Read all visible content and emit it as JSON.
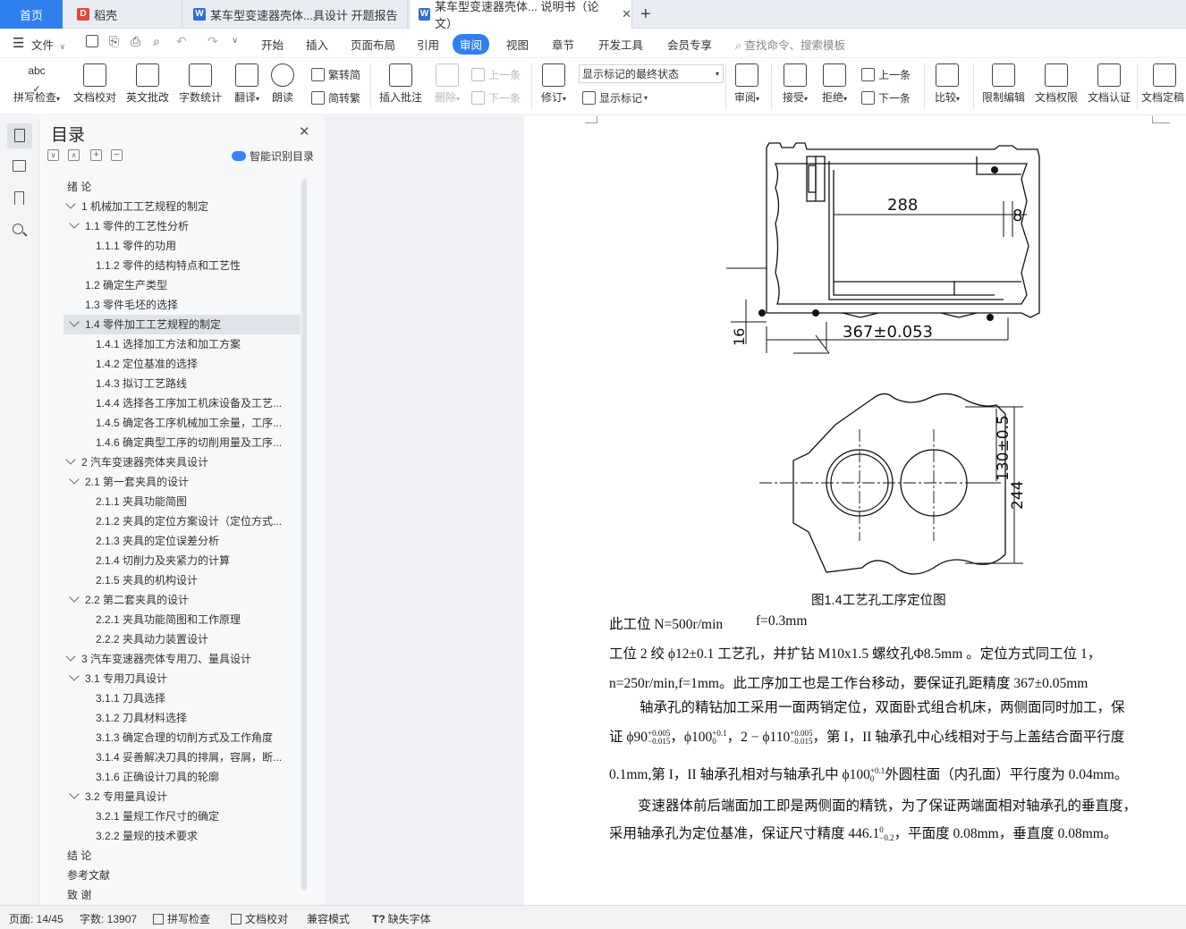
{
  "tabs": {
    "home": "首页",
    "daoke": "稻壳",
    "tab1": "某车型变速器壳体...具设计 开题报告",
    "tab2": "某车型变速器壳体... 说明书（论文）",
    "add": "+"
  },
  "menubar": {
    "file": "文件",
    "items": [
      "开始",
      "插入",
      "页面布局",
      "引用",
      "审阅",
      "视图",
      "章节",
      "开发工具",
      "会员专享"
    ],
    "active_index": 4,
    "search": "查找命令、搜索模板"
  },
  "ribbon": {
    "spell": "拼写检查",
    "proof": "文档校对",
    "en_review": "英文批改",
    "wordcount": "字数统计",
    "translate": "翻译",
    "read": "朗读",
    "trad": "繁转简",
    "simp": "简转繁",
    "insert_comment": "插入批注",
    "delete": "删除",
    "prev_comment": "上一条",
    "next_comment": "下一条",
    "revise": "修订",
    "markup_state": "显示标记的最终状态",
    "show_markup": "显示标记",
    "review": "审阅",
    "accept": "接受",
    "reject": "拒绝",
    "prev_change": "上一条",
    "next_change": "下一条",
    "compare": "比较",
    "restrict": "限制编辑",
    "permission": "文档权限",
    "certify": "文档认证",
    "finalize": "文档定稿"
  },
  "toc": {
    "title": "目录",
    "smart": "智能识别目录",
    "items": [
      {
        "text": "绪  论",
        "level": 0,
        "chev": false
      },
      {
        "text": "1  机械加工工艺规程的制定",
        "level": 0,
        "chev": true
      },
      {
        "text": "1.1  零件的工艺性分析",
        "level": 1,
        "chev": true
      },
      {
        "text": "1.1.1  零件的功用",
        "level": 2,
        "chev": false
      },
      {
        "text": "1.1.2  零件的结构特点和工艺性",
        "level": 2,
        "chev": false
      },
      {
        "text": "1.2  确定生产类型",
        "level": 1,
        "chev": false
      },
      {
        "text": "1.3  零件毛坯的选择",
        "level": 1,
        "chev": false
      },
      {
        "text": "1.4  零件加工工艺规程的制定",
        "level": 1,
        "chev": true,
        "selected": true
      },
      {
        "text": "1.4.1  选择加工方法和加工方案",
        "level": 2,
        "chev": false
      },
      {
        "text": "1.4.2  定位基准的选择",
        "level": 2,
        "chev": false
      },
      {
        "text": "1.4.3  拟订工艺路线",
        "level": 2,
        "chev": false
      },
      {
        "text": "1.4.4  选择各工序加工机床设备及工艺...",
        "level": 2,
        "chev": false
      },
      {
        "text": "1.4.5  确定各工序机械加工余量，工序...",
        "level": 2,
        "chev": false
      },
      {
        "text": "1.4.6  确定典型工序的切削用量及工序...",
        "level": 2,
        "chev": false
      },
      {
        "text": "2  汽车变速器壳体夹具设计",
        "level": 0,
        "chev": true
      },
      {
        "text": "2.1  第一套夹具的设计",
        "level": 1,
        "chev": true
      },
      {
        "text": "2.1.1  夹具功能简图",
        "level": 2,
        "chev": false
      },
      {
        "text": "2.1.2  夹具的定位方案设计（定位方式...",
        "level": 2,
        "chev": false
      },
      {
        "text": "2.1.3  夹具的定位误差分析",
        "level": 2,
        "chev": false
      },
      {
        "text": "2.1.4  切削力及夹紧力的计算",
        "level": 2,
        "chev": false
      },
      {
        "text": "2.1.5  夹具的机构设计",
        "level": 2,
        "chev": false
      },
      {
        "text": "2.2  第二套夹具的设计",
        "level": 1,
        "chev": true
      },
      {
        "text": "2.2.1  夹具功能简图和工作原理",
        "level": 2,
        "chev": false
      },
      {
        "text": "2.2.2  夹具动力装置设计",
        "level": 2,
        "chev": false
      },
      {
        "text": "3  汽车变速器壳体专用刀、量具设计",
        "level": 0,
        "chev": true
      },
      {
        "text": "3.1  专用刀具设计",
        "level": 1,
        "chev": true
      },
      {
        "text": "3.1.1  刀具选择",
        "level": 2,
        "chev": false
      },
      {
        "text": "3.1.2  刀具材料选择",
        "level": 2,
        "chev": false
      },
      {
        "text": "3.1.3  确定合理的切削方式及工作角度",
        "level": 2,
        "chev": false
      },
      {
        "text": "3.1.4  妥善解决刀具的排屑，容屑，断...",
        "level": 2,
        "chev": false
      },
      {
        "text": "3.1.6  正确设计刀具的轮廓",
        "level": 2,
        "chev": false
      },
      {
        "text": "3.2  专用量具设计",
        "level": 1,
        "chev": true
      },
      {
        "text": "3.2.1  量规工作尺寸的确定",
        "level": 2,
        "chev": false
      },
      {
        "text": "3.2.2  量规的技术要求",
        "level": 2,
        "chev": false
      },
      {
        "text": "结  论",
        "level": 0,
        "chev": false
      },
      {
        "text": "参考文献",
        "level": 0,
        "chev": false
      },
      {
        "text": "致  谢",
        "level": 0,
        "chev": false
      }
    ]
  },
  "drawing": {
    "dim_288": "288",
    "dim_8": "8",
    "dim_16": "16",
    "dim_367": "367±0.053",
    "dim_130": "130±0.5",
    "dim_244": "244"
  },
  "doc": {
    "caption": "图1.4工艺孔工序定位图",
    "l1a": "此工位 N=500r/min",
    "l1b": "f=0.3mm",
    "l2": "工位 2 绞 ϕ12±0.1 工艺孔，并扩钻 M10x1.5 螺纹孔Φ8.5mm 。定位方式同工位 1，",
    "l3": "n=250r/min,f=1mm。此工序加工也是工作台移动，要保证孔距精度 367±0.05mm",
    "l4": "轴承孔的精钻加工采用一面两销定位，双面卧式组合机床，两侧面同时加工，保",
    "l5a": "证 ϕ90",
    "l5_sup1": "+0.005",
    "l5_sub1": "−0.015",
    "l5b": "，ϕ100",
    "l5_sup2": "+0.1",
    "l5_sub2": "0",
    "l5c": "，2 − ϕ110",
    "l5_sup3": "+0.005",
    "l5_sub3": "−0.015",
    "l5d": "，第 I，II 轴承孔中心线相对于与上盖结合面平行度",
    "l6a": "0.1mm,第 I，II 轴承孔相对与轴承孔中 ϕ100",
    "l6_sup": "+0.1",
    "l6_sub": "0",
    "l6b": "外圆柱面（内孔面）平行度为 0.04mm。",
    "l7": "变速器体前后端面加工即是两侧面的精铣，为了保证两端面相对轴承孔的垂直度，",
    "l8a": "采用轴承孔为定位基准，保证尺寸精度 446.1",
    "l8_sup": "0",
    "l8_sub": "−0.2",
    "l8b": "，平面度 0.08mm，垂直度 0.08mm。"
  },
  "status": {
    "page": "页面: 14/45",
    "words": "字数: 13907",
    "spell": "拼写检查",
    "proof": "文档校对",
    "compat": "兼容模式",
    "missing_font": "缺失字体"
  },
  "colors": {
    "accent": "#2f80ed",
    "tab_active_bg": "#ffffff",
    "selected_row": "#dfe3e9"
  }
}
